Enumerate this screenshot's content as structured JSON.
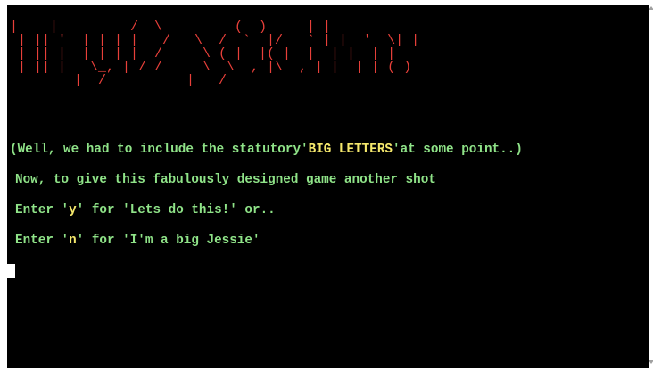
{
  "terminal": {
    "banner_art": "|    |         /  \\         (  )     | |\n | || '  | | | |   /   \\  /  `  |/   ` | |  '  \\| |\n | || |  | | | |  /     \\ ( |  |( |  |  | |  | |\n | || |   \\_, | / /     \\  \\  , |\\  , | |  | | ( )\n        |  /          |   /",
    "line1_prefix": "(Well, we had to include the statutory'",
    "line1_highlight": "BIG LETTERS",
    "line1_suffix": "'at some point..)",
    "line2": "Now, to give this fabulously designed game another shot",
    "line3_prefix": "Enter '",
    "line3_key": "y",
    "line3_suffix": "' for 'Lets do this!' or..",
    "line4_prefix": "Enter '",
    "line4_key": "n",
    "line4_suffix": "' for 'I'm a big Jessie'"
  },
  "colors": {
    "background": "#000000",
    "text": "#8fe388",
    "highlight": "#f5e86c",
    "banner": "#e8403a"
  }
}
